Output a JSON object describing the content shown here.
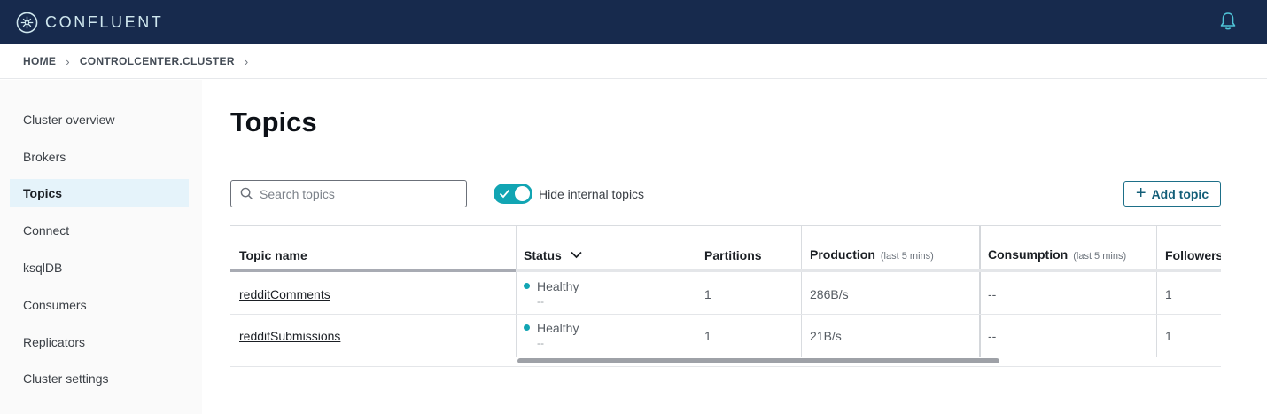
{
  "brand": {
    "name": "CONFLUENT",
    "accent": "#12a5b3",
    "topbar_color": "#172a4d"
  },
  "header": {
    "notification_icon": "bell-icon"
  },
  "breadcrumb": {
    "items": [
      "HOME",
      "CONTROLCENTER.CLUSTER"
    ]
  },
  "sidebar": {
    "items": [
      {
        "label": "Cluster overview",
        "active": false
      },
      {
        "label": "Brokers",
        "active": false
      },
      {
        "label": "Topics",
        "active": true
      },
      {
        "label": "Connect",
        "active": false
      },
      {
        "label": "ksqlDB",
        "active": false
      },
      {
        "label": "Consumers",
        "active": false
      },
      {
        "label": "Replicators",
        "active": false
      },
      {
        "label": "Cluster settings",
        "active": false
      }
    ]
  },
  "main": {
    "title": "Topics",
    "search": {
      "placeholder": "Search topics",
      "value": ""
    },
    "toggle": {
      "label": "Hide internal topics",
      "on": true
    },
    "add_button": {
      "label": "Add topic"
    }
  },
  "table": {
    "columns": [
      {
        "label": "Topic name",
        "sub": ""
      },
      {
        "label": "Status",
        "sub": ""
      },
      {
        "label": "Partitions",
        "sub": ""
      },
      {
        "label": "Production",
        "sub": "(last 5 mins)"
      },
      {
        "label": "Consumption",
        "sub": "(last 5 mins)"
      },
      {
        "label": "Followers",
        "sub": ""
      }
    ],
    "rows": [
      {
        "name": "redditComments",
        "status": "Healthy",
        "status_sub": "--",
        "partitions": "1",
        "production": "286B/s",
        "consumption": "--",
        "followers": "1"
      },
      {
        "name": "redditSubmissions",
        "status": "Healthy",
        "status_sub": "--",
        "partitions": "1",
        "production": "21B/s",
        "consumption": "--",
        "followers": "1"
      }
    ]
  }
}
